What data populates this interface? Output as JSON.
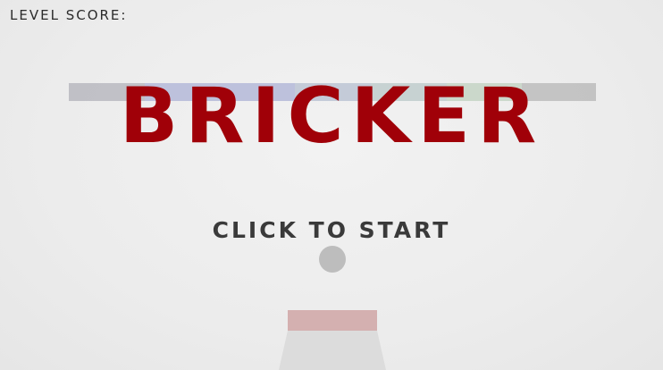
{
  "hud": {
    "level_score_label": "LEVEL SCORE:"
  },
  "title": {
    "text": "BRICKER",
    "color": "#a00008"
  },
  "prompt": {
    "text": "CLICK TO START"
  },
  "bricks": [
    {
      "color": "#b8b8c0"
    },
    {
      "color": "#b4b8d8"
    },
    {
      "color": "#bcc4d4"
    },
    {
      "color": "#c0cccc"
    },
    {
      "color": "#c4d4c4"
    },
    {
      "color": "#bcbcbc"
    }
  ],
  "ball": {
    "color": "#bdbdbd"
  },
  "paddle": {
    "color": "#d4b0b0",
    "shadow_color": "#dcdcdc"
  }
}
